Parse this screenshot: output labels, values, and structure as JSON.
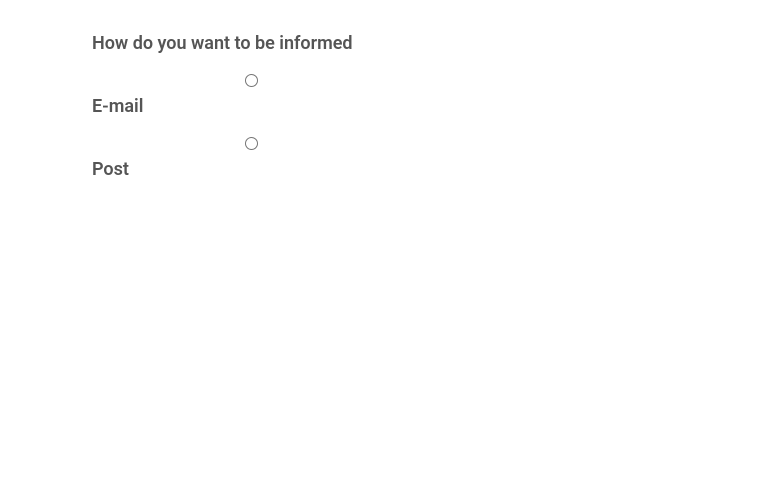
{
  "form": {
    "question": "How do you want to be informed",
    "options": [
      {
        "label": "E-mail"
      },
      {
        "label": "Post"
      }
    ]
  }
}
